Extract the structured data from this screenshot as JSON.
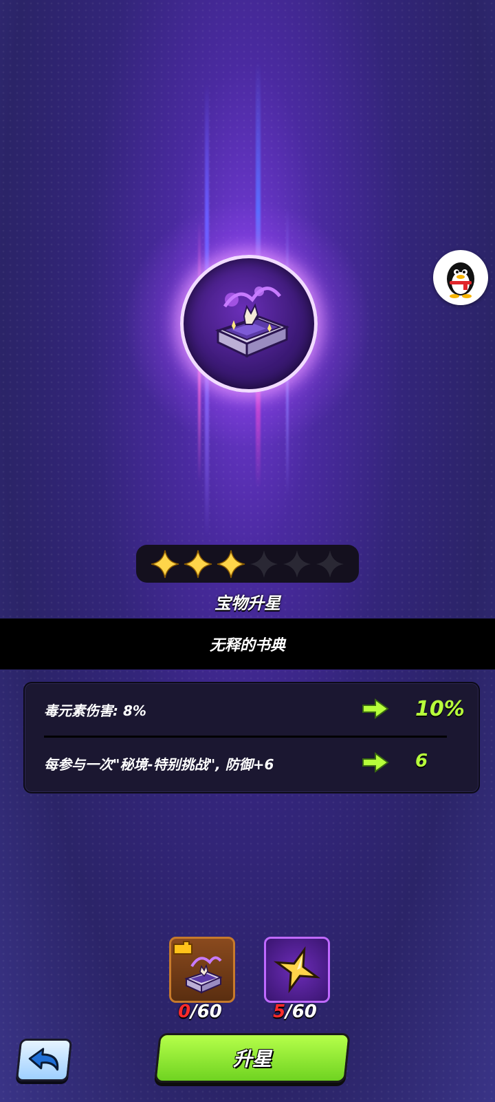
{
  "treasure": {
    "stars_filled": 3,
    "stars_total": 6,
    "section_title": "宝物升星",
    "name": "无释的书典"
  },
  "attributes": [
    {
      "label": "毒元素伤害: 8%",
      "next_value": "10%"
    },
    {
      "label": "每参与一次\"秘境-特别挑战\", 防御+6",
      "next_value": "6"
    }
  ],
  "materials": [
    {
      "icon": "treasure-fragment-icon",
      "have": "0",
      "need": "/60"
    },
    {
      "icon": "star-stone-icon",
      "have": "5",
      "need": "/60"
    }
  ],
  "buttons": {
    "upgrade_label": "升星",
    "back_icon": "back-arrow-icon"
  },
  "colors": {
    "accent_green": "#b7ff3b",
    "insufficient_red": "#ff2b2b",
    "star_gold": "#ffd54a"
  }
}
